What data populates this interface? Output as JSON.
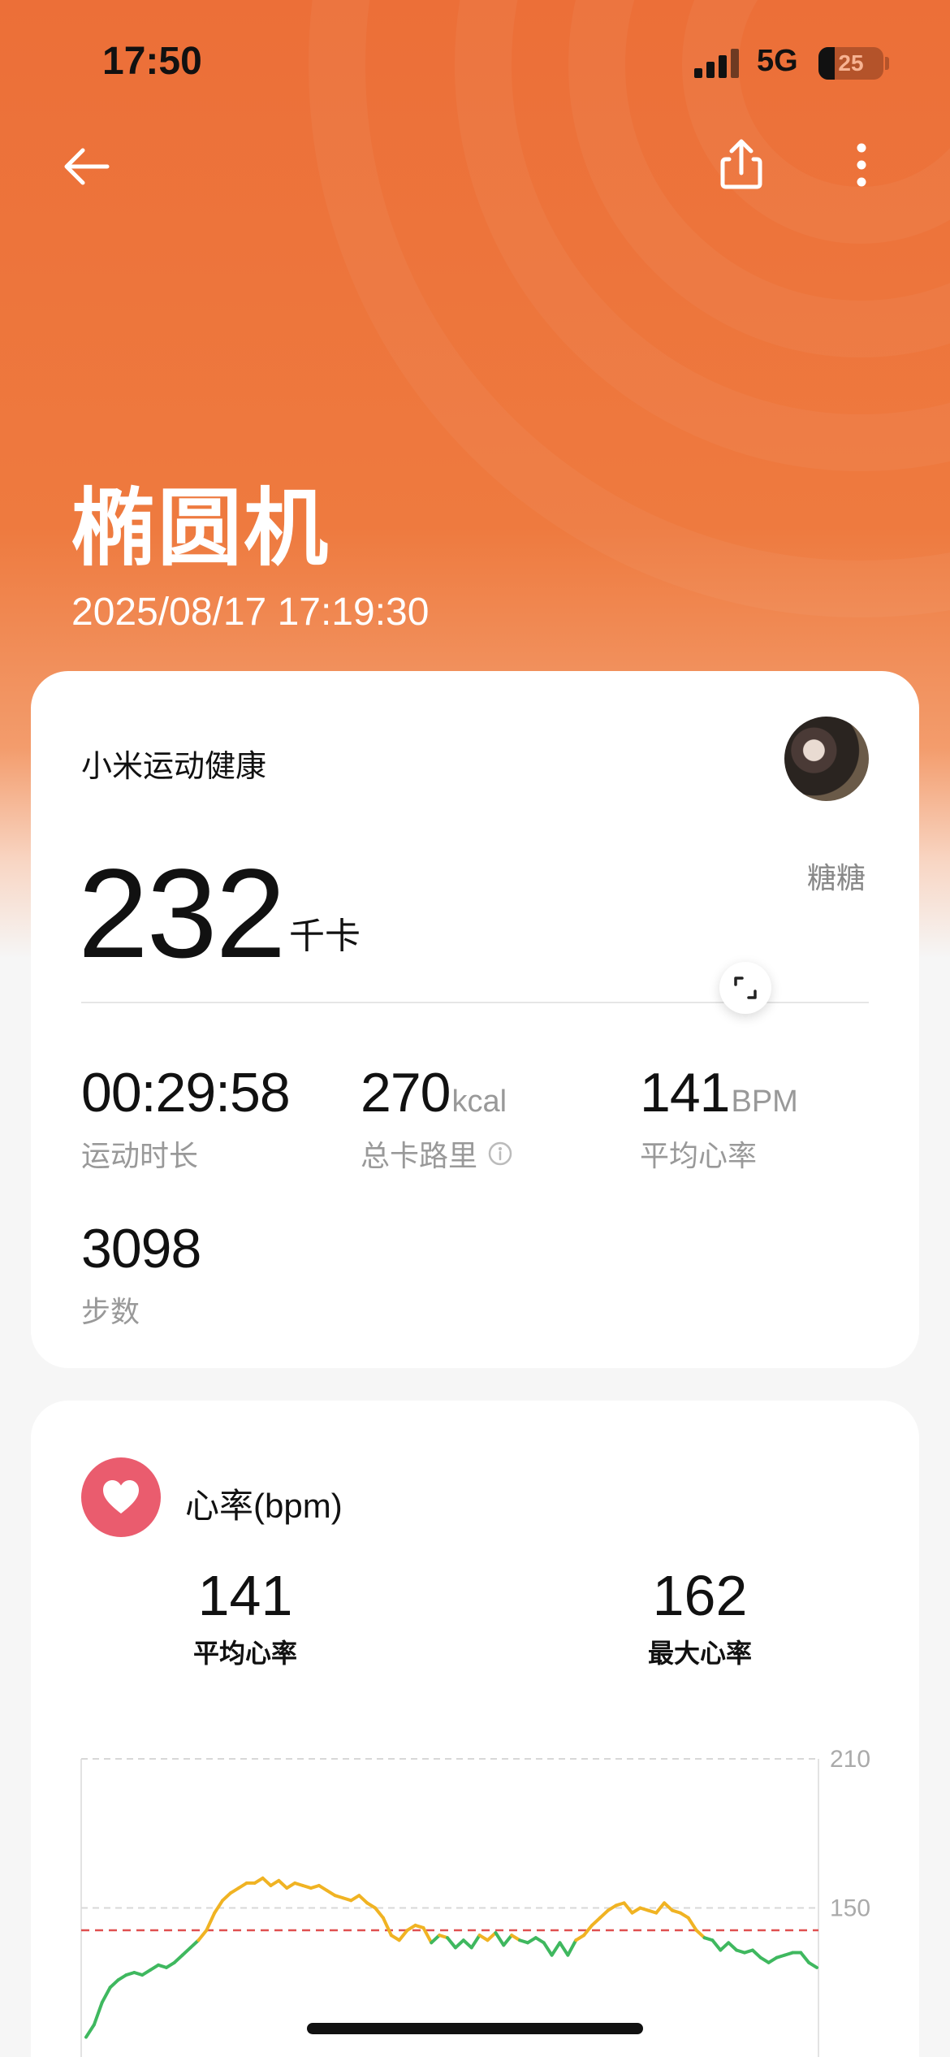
{
  "status_bar": {
    "time": "17:50",
    "network": "5G",
    "battery": "25",
    "battery_level_percent": 25
  },
  "header": {
    "back_icon": "arrow-left-icon",
    "share_icon": "share-icon",
    "more_icon": "more-vertical-icon"
  },
  "workout": {
    "title": "椭圆机",
    "datetime": "2025/08/17 17:19:30"
  },
  "summary_card": {
    "brand": "小米运动健康",
    "username": "糖糖",
    "calories_value": "232",
    "calories_unit": "千卡",
    "metrics": [
      {
        "value": "00:29:58",
        "unit": "",
        "label": "运动时长"
      },
      {
        "value": "270",
        "unit": "kcal",
        "label": "总卡路里"
      },
      {
        "value": "141",
        "unit": "BPM",
        "label": "平均心率"
      },
      {
        "value": "3098",
        "unit": "",
        "label": "步数"
      }
    ]
  },
  "heart_rate_card": {
    "title": "心率(bpm)",
    "avg_value": "141",
    "avg_label": "平均心率",
    "max_value": "162",
    "max_label": "最大心率",
    "expand_icon": "expand-icon"
  },
  "colors": {
    "accent_orange": "#ec6f38",
    "heart_red": "#ea5c6e",
    "zone_yellow": "#f0b323",
    "zone_green": "#3fb85f",
    "zone_blue": "#3ba6e8",
    "avg_line_red": "#e05050"
  },
  "chart_data": {
    "type": "line",
    "title": "",
    "xlabel": "",
    "ylabel": "",
    "y_ticks": [
      "210",
      "150"
    ],
    "ylim": [
      90,
      210
    ],
    "avg_line": 141,
    "grid": "dashed horizontal at y ticks",
    "series": [
      {
        "values": [
          98,
          103,
          112,
          118,
          121,
          123,
          124,
          123,
          125,
          127,
          126,
          128,
          131,
          134,
          137,
          141,
          148,
          153,
          156,
          158,
          160,
          160,
          162,
          159,
          161,
          158,
          160,
          159,
          158,
          159,
          157,
          155,
          154,
          153,
          155,
          152,
          150,
          146,
          139,
          137,
          141,
          143,
          142,
          136,
          139,
          138,
          134,
          137,
          134,
          139,
          137,
          140,
          135,
          139,
          137,
          136,
          138,
          136,
          131,
          136,
          131,
          137,
          139,
          143,
          146,
          149,
          151,
          152,
          148,
          150,
          149,
          148,
          152,
          149,
          148,
          146,
          141,
          138,
          137,
          133,
          136,
          133,
          132,
          133,
          130,
          128,
          130,
          131,
          132,
          132,
          128,
          126
        ]
      }
    ]
  }
}
